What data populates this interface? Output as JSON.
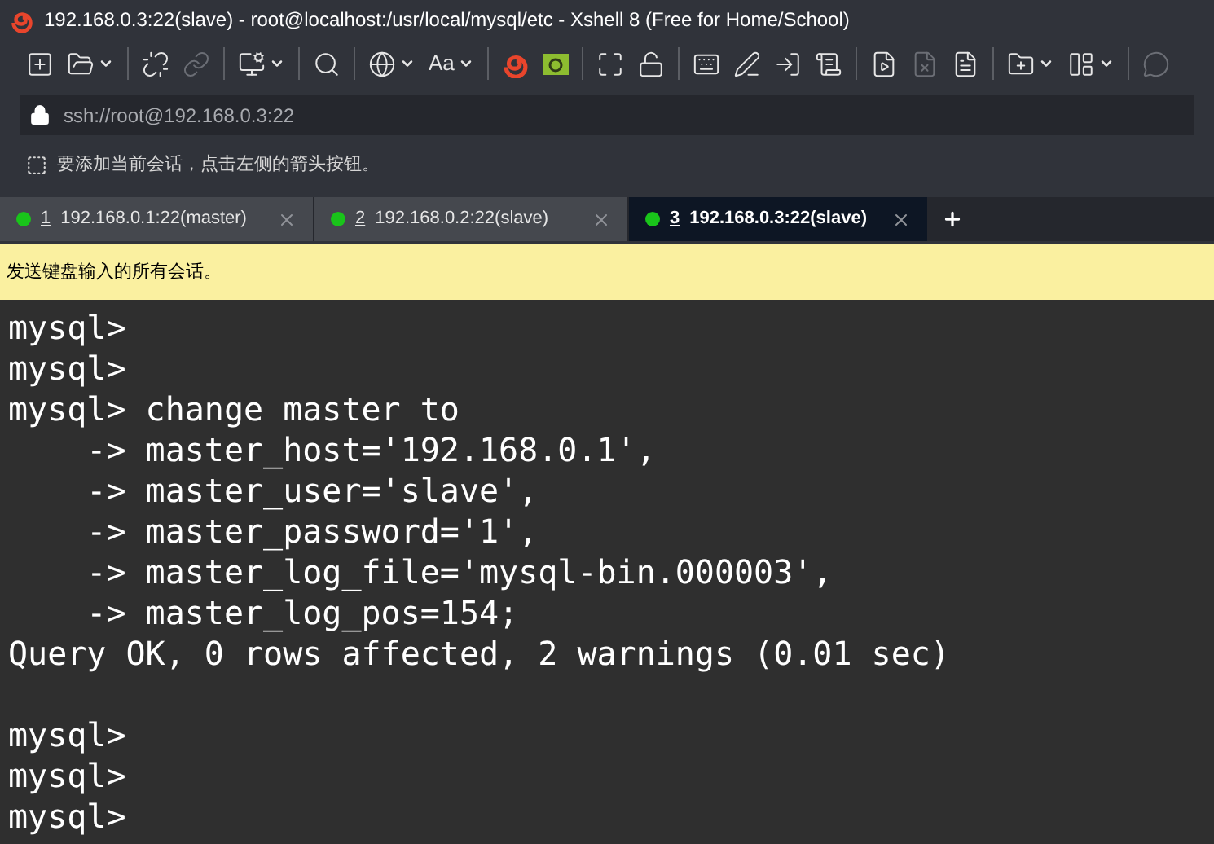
{
  "window": {
    "title": "192.168.0.3:22(slave) - root@localhost:/usr/local/mysql/etc - Xshell 8 (Free for Home/School)"
  },
  "toolbar": [
    [
      {
        "dropdown": false,
        "disabled": false
      },
      {
        "dropdown": true,
        "disabled": false
      }
    ],
    [
      {
        "dropdown": false,
        "disabled": false
      },
      {
        "dropdown": false,
        "disabled": true
      }
    ],
    [
      {
        "dropdown": true,
        "disabled": false
      }
    ],
    [
      {
        "dropdown": false,
        "disabled": false
      }
    ],
    [
      {
        "dropdown": true,
        "disabled": false
      },
      {
        "dropdown": true,
        "disabled": false,
        "label": "Aa"
      }
    ],
    [
      {
        "dropdown": false,
        "disabled": false
      },
      {
        "dropdown": false,
        "disabled": false
      }
    ],
    [
      {
        "dropdown": false,
        "disabled": false
      },
      {
        "dropdown": false,
        "disabled": false
      }
    ],
    [
      {
        "dropdown": false,
        "disabled": false
      },
      {
        "dropdown": false,
        "disabled": false
      },
      {
        "dropdown": false,
        "disabled": false
      },
      {
        "dropdown": false,
        "disabled": false
      }
    ],
    [
      {
        "dropdown": false,
        "disabled": false
      },
      {
        "dropdown": false,
        "disabled": true
      },
      {
        "dropdown": false,
        "disabled": false
      }
    ],
    [
      {
        "dropdown": true,
        "disabled": false
      },
      {
        "dropdown": true,
        "disabled": false
      }
    ],
    [
      {
        "dropdown": false,
        "disabled": true
      }
    ]
  ],
  "address": {
    "value": "ssh://root@192.168.0.3:22"
  },
  "hint": "要添加当前会话，点击左侧的箭头按钮。",
  "tabs": [
    {
      "number": "1",
      "label": "192.168.0.1:22(master)",
      "selected": false
    },
    {
      "number": "2",
      "label": "192.168.0.2:22(slave)",
      "selected": false
    },
    {
      "number": "3",
      "label": "192.168.0.3:22(slave)",
      "selected": true
    }
  ],
  "broadcast_bar": "发送键盘输入的所有会话。",
  "terminal": {
    "blocks": [
      [
        "mysql>",
        "mysql>",
        "mysql> change master to",
        "    -> master_host='192.168.0.1',",
        "    -> master_user='slave',",
        "    -> master_password='1',",
        "    -> master_log_file='mysql-bin.000003',",
        "    -> master_log_pos=154;",
        "Query OK, 0 rows affected, 2 warnings (0.01 sec)"
      ],
      [
        "mysql>",
        "mysql>",
        "mysql>"
      ]
    ]
  }
}
